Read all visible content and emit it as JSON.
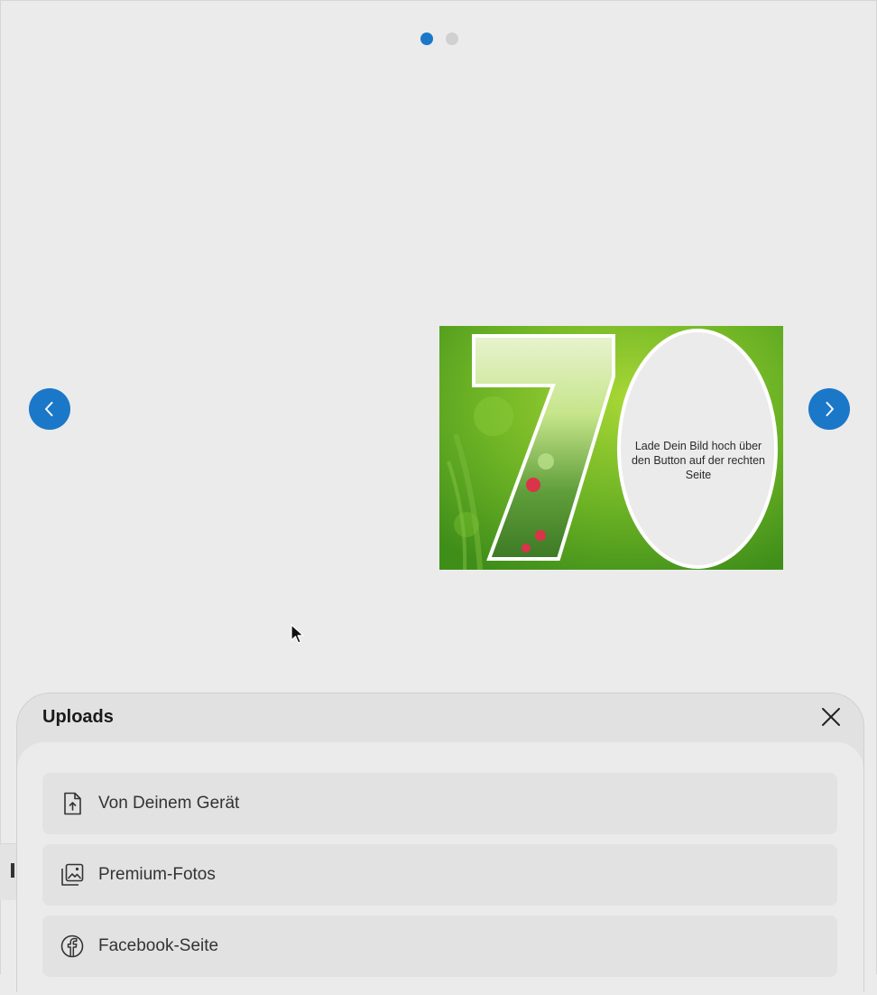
{
  "pager": {
    "count": 2,
    "active_index": 0
  },
  "card": {
    "number": "70",
    "placeholder_text": "Lade Dein Bild hoch über den Button auf der rechten Seite",
    "colors": {
      "green_dark": "#4f9d1c",
      "green_light": "#9ccd2c"
    }
  },
  "uploads": {
    "title": "Uploads",
    "options": [
      {
        "label": "Von Deinem Gerät",
        "icon": "upload-file-icon"
      },
      {
        "label": "Premium-Fotos",
        "icon": "photo-library-icon"
      },
      {
        "label": "Facebook-Seite",
        "icon": "facebook-icon"
      }
    ]
  },
  "colors": {
    "accent": "#1b78c8",
    "background": "#ebebeb",
    "panel_header": "#e1e1e1"
  }
}
